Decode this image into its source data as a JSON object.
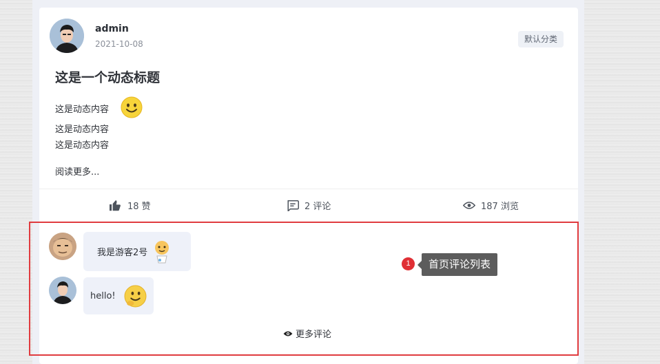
{
  "post": {
    "author": "admin",
    "date": "2021-10-08",
    "category": "默认分类",
    "title": "这是一个动态标题",
    "content_lines": [
      "这是动态内容",
      "这是动态内容",
      "这是动态内容"
    ],
    "read_more": "阅读更多..."
  },
  "stats": {
    "likes": "18 赞",
    "comments": "2 评论",
    "views": "187 浏览"
  },
  "comments": [
    {
      "text": "我是游客2号"
    },
    {
      "text": "hello!"
    }
  ],
  "more_comments": "更多评论",
  "annotation": {
    "badge": "1",
    "label": "首页评论列表"
  },
  "colors": {
    "highlight_border": "#e03a3e",
    "bubble_bg": "#eef1f9",
    "annotation_bg": "#5c5c5c",
    "badge_bg": "#e02f35"
  }
}
